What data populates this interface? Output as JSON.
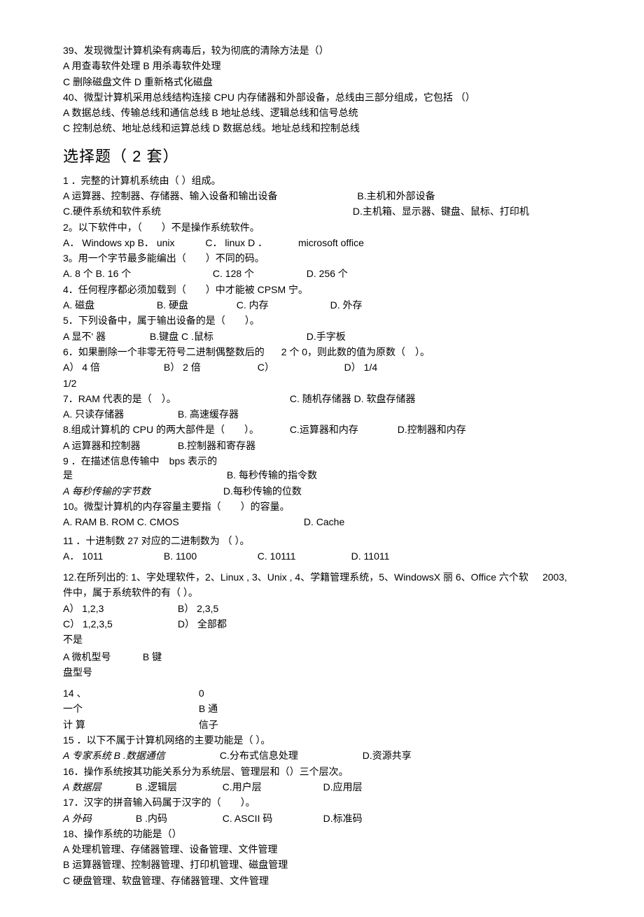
{
  "prelim": {
    "q39": "39、发现微型计算机染有病毒后，较为彻底的清除方法是（）",
    "q39_ab": "A 用查毒软件处理 B 用杀毒软件处理",
    "q39_cd": "C 删除磁盘文件 D 重新格式化磁盘",
    "q40": "40、微型计算机采用总线结构连接 CPU 内存储器和外部设备，总线由三部分组成，它包括 （）",
    "q40_ab": "A 数据总线、传输总线和通信总线 B 地址总线、逻辑总线和信号总统",
    "q40_cd": "C 控制总统、地址总线和运算总线 D 数据总线。地址总线和控制总线"
  },
  "heading": "选择题（ 2 套）",
  "q1": {
    "stem": "1 ．完整的计算机系统由（ ）组成。",
    "a": "A 运算器、控制器、存储器、输入设备和输出设备",
    "b": "B.主机和外部设备",
    "c": "C.硬件系统和软件系统",
    "d": "D.主机箱、显示器、键盘、鼠标、打印机"
  },
  "q2": {
    "stem": "2。以下软件中，（　　）不是操作系统软件。",
    "a": "A． Windows xp B． unix",
    "c": "C． linux D ．",
    "d": "microsoft office"
  },
  "q3": {
    "stem": "3。用一个字节最多能编出（　　）不同的码。",
    "a": "A. 8 个 B. 16 个",
    "c": "C. 128 个",
    "d": "D. 256 个"
  },
  "q4": {
    "stem": "4．任何程序都必须加载到（　　）中才能被 CPSM 宁。",
    "a": "A. 磁盘",
    "b": "B. 硬盘",
    "c": "C. 内存",
    "d": "D. 外存"
  },
  "q5": {
    "stem": "5．下列设备中，属于输出设备的是（　　）。",
    "a": "A 显不' 器",
    "b": "B.键盘 C .鼠标",
    "d": "D.手字板"
  },
  "q6": {
    "stem_l": "6．如果删除一个非零无符号二进制偶整数后的",
    "stem_r": "2 个 0，则此数的值为原数（　）。",
    "a": "A） 4 倍",
    "b": "B） 2 倍",
    "c": "C）",
    "d": "D） 1/4",
    "extra": "1/2"
  },
  "q7": {
    "stem": "7．RAM 代表的是（　）。",
    "c": "C. 随机存储器 D. 软盘存储器",
    "a": "A. 只读存储器",
    "b": "B. 高速缓存器"
  },
  "q8": {
    "stem": "8.组成计算机的 CPU 的两大部件是（　　）。",
    "c": "C.运算器和内存",
    "d": "D.控制器和内存",
    "a": "A 运算器和控制器",
    "b": "B.控制器和寄存器"
  },
  "q9": {
    "stem_l": "9 ．在描述信息传输中　bps 表示的是",
    "b": "B. 每秒传输的指令数",
    "a": "A 每秒传输的字节数",
    "d": "D.每秒传输的位数"
  },
  "q10": {
    "stem": "10。微型计算机的内存容量主要指（　　）的容量。",
    "opts": "A. RAM B. ROM C. CMOS",
    "d": "D. Cache"
  },
  "q11": {
    "stem": "11 ．十进制数 27 对应的二进制数为 （ ）。",
    "a": "A． 1011",
    "b": "B. 1100",
    "c": "C. 10111",
    "d": "D. 11011"
  },
  "q12": {
    "stem_l": "12.在所列出的: 1、字处理软件，2、Linux , 3、Unix , 4、学籍管理系统，5、WindowsX 丽 6、Office 六个软",
    "stem_r": "2003,",
    "stem2": "件中，属于系统软件的有（ ）。",
    "a": "A） 1,2,3",
    "b": "B） 2,3,5",
    "c": "C） 1,2,3,5",
    "d": "D） 全部都",
    "tail1": "不是",
    "frag1": "A 微机型号",
    "frag2": "B 键",
    "frag3": "盘型号"
  },
  "q14": {
    "l1a": "14 、",
    "l1b": "0",
    "l2a": "一个",
    "l2b": "B 通",
    "l3a": "计 算",
    "l3b": "信子"
  },
  "q15": {
    "stem": "15 ．以下不属于计算机网络的主要功能是（ ）。",
    "ab": "A 专家系统 B .数据通信",
    "c": "C.分布式信息处理",
    "d": "D.资源共享"
  },
  "q16": {
    "stem": "16．操作系统按其功能关系分为系统层、管理层和（）三个层次。",
    "a": "A 数据层",
    "b": "B .逻辑层",
    "c": "C.用户层",
    "d": "D.应用层"
  },
  "q17": {
    "stem": "17．汉字的拼音输入码属于汉字的（　　）。",
    "a": "A 外码",
    "b": "B .内码",
    "c": "C. ASCII 码",
    "d": "D.标准码"
  },
  "q18": {
    "stem": "18、操作系统的功能是（）",
    "a": "A 处理机管理、存储器管理、设备管理、文件管理",
    "b": "B 运算器管理、控制器管理、打印机管理、磁盘管理",
    "c": "C 硬盘管理、软盘管理、存储器管理、文件管理"
  }
}
